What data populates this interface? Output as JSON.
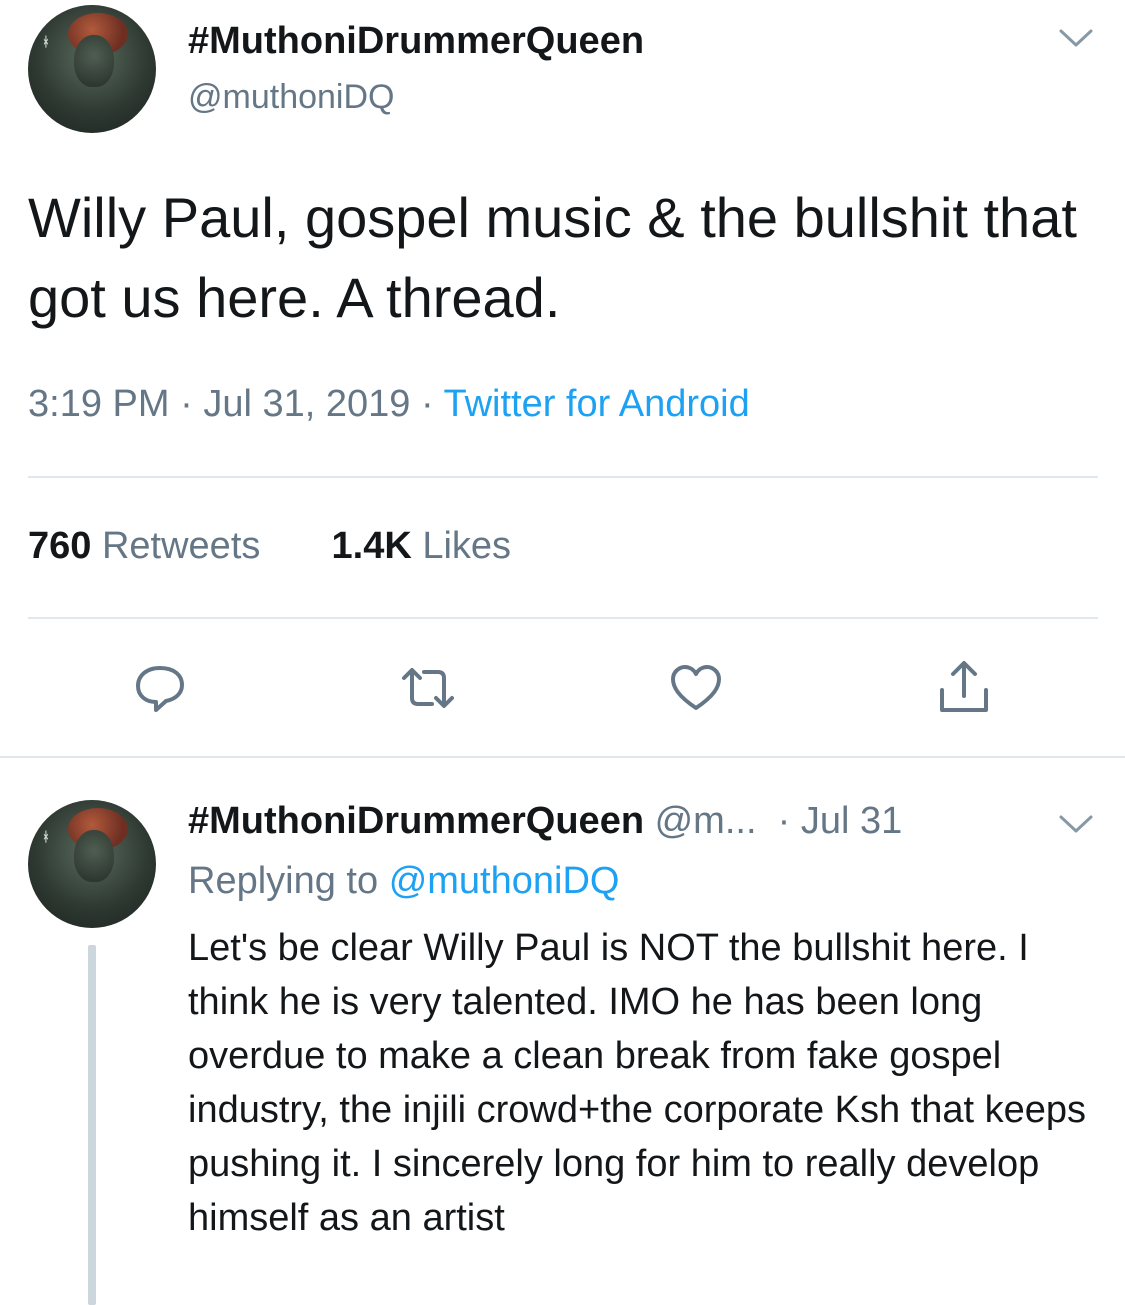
{
  "tweet": {
    "author_name": "#MuthoniDrummerQueen",
    "author_handle": "@muthoniDQ",
    "text": "Willy Paul, gospel music & the bullshit that got us here. A thread.",
    "time": "3:19 PM",
    "date": "Jul 31, 2019",
    "source": "Twitter for Android",
    "retweet_count": "760",
    "retweet_label": "Retweets",
    "like_count": "1.4K",
    "like_label": "Likes",
    "actions": [
      {
        "icon": "reply-icon"
      },
      {
        "icon": "retweet-icon"
      },
      {
        "icon": "heart-icon"
      },
      {
        "icon": "share-icon"
      }
    ],
    "menu_icon": "chevron-down-icon"
  },
  "reply": {
    "author_name": "#MuthoniDrummerQueen",
    "author_handle": "@m...",
    "date": "Jul 31",
    "replying_prefix": "Replying to",
    "replying_to": "@muthoniDQ",
    "text": "Let's be clear Willy Paul is NOT the bullshit here. I think he is very talented. IMO he has been long overdue to make a clean break from fake gospel industry, the injili crowd+the corporate Ksh that keeps pushing it. I sincerely long for him to really develop himself as an artist",
    "menu_icon": "chevron-down-icon"
  },
  "colors": {
    "text": "#14171a",
    "secondary": "#657786",
    "accent": "#1da1f2",
    "divider": "#e1e8ed",
    "thread_line": "#ccd6dd"
  }
}
